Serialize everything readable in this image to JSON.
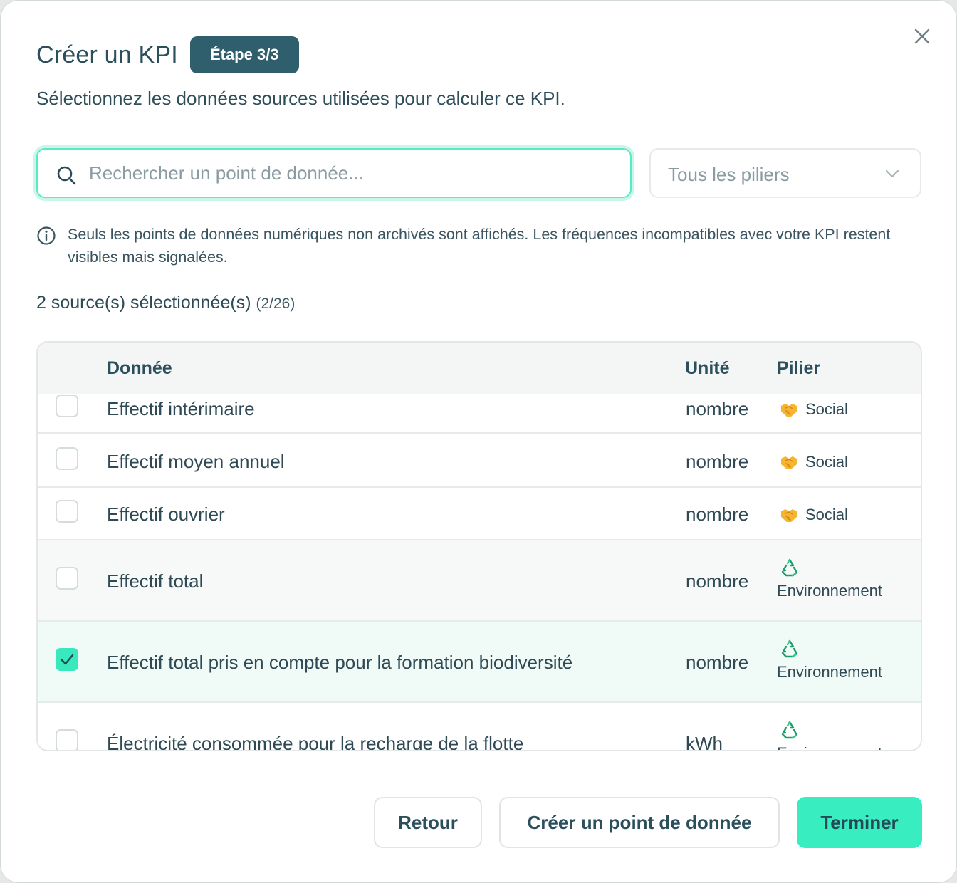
{
  "modal": {
    "title": "Créer un KPI",
    "step_badge": "Étape 3/3",
    "subtitle": "Sélectionnez les données sources utilisées pour calculer ce KPI.",
    "close_icon": "close-icon"
  },
  "search": {
    "placeholder": "Rechercher un point de donnée...",
    "value": "",
    "icon": "search-icon"
  },
  "pillar_filter": {
    "selected": "Tous les piliers",
    "icon": "chevron-down-icon"
  },
  "info": {
    "icon": "info-icon",
    "text": "Seuls les points de données numériques non archivés sont affichés. Les fréquences incompatibles avec votre KPI restent visibles mais signalées."
  },
  "selection": {
    "label": "2 source(s) sélectionnée(s)",
    "fraction": "(2/26)"
  },
  "table": {
    "headers": {
      "name": "Donnée",
      "unit": "Unité",
      "pillar": "Pilier"
    },
    "rows": [
      {
        "name": "Effectif intérimaire",
        "unit": "nombre",
        "pillar": "Social",
        "pillar_icon": "handshake-icon",
        "checked": false
      },
      {
        "name": "Effectif moyen annuel",
        "unit": "nombre",
        "pillar": "Social",
        "pillar_icon": "handshake-icon",
        "checked": false
      },
      {
        "name": "Effectif ouvrier",
        "unit": "nombre",
        "pillar": "Social",
        "pillar_icon": "handshake-icon",
        "checked": false
      },
      {
        "name": "Effectif total",
        "unit": "nombre",
        "pillar": "Environnement",
        "pillar_icon": "recycle-icon",
        "checked": false
      },
      {
        "name": "Effectif total pris en compte pour la formation biodiversité",
        "unit": "nombre",
        "pillar": "Environnement",
        "pillar_icon": "recycle-icon",
        "checked": true
      },
      {
        "name": "Électricité consommée pour la recharge de la flotte",
        "unit": "kWh",
        "pillar": "Environnement",
        "pillar_icon": "recycle-icon",
        "checked": false
      }
    ]
  },
  "footer": {
    "back_label": "Retour",
    "create_label": "Créer un point de donnée",
    "finish_label": "Terminer"
  },
  "colors": {
    "accent": "#38edbf",
    "badge": "#2f5e6c",
    "text": "#2c4f5c"
  }
}
